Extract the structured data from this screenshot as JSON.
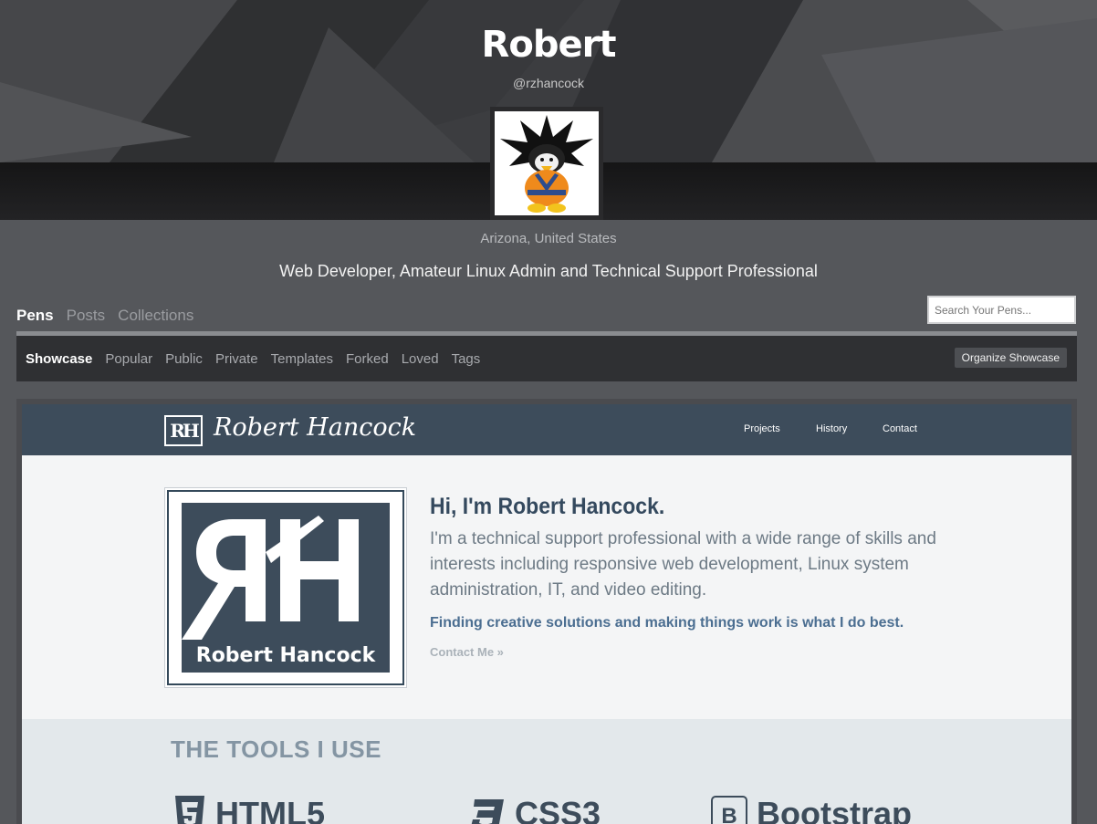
{
  "profile": {
    "name": "Robert",
    "handle": "@rzhancock",
    "location": "Arizona, United States",
    "bio": "Web Developer, Amateur Linux Admin and Technical Support Professional"
  },
  "main_tabs": [
    {
      "label": "Pens",
      "active": true
    },
    {
      "label": "Posts",
      "active": false
    },
    {
      "label": "Collections",
      "active": false
    }
  ],
  "search": {
    "placeholder": "Search Your Pens..."
  },
  "sub_tabs": [
    {
      "label": "Showcase",
      "active": true
    },
    {
      "label": "Popular",
      "active": false
    },
    {
      "label": "Public",
      "active": false
    },
    {
      "label": "Private",
      "active": false
    },
    {
      "label": "Templates",
      "active": false
    },
    {
      "label": "Forked",
      "active": false
    },
    {
      "label": "Loved",
      "active": false
    },
    {
      "label": "Tags",
      "active": false
    }
  ],
  "organize_button": "Organize Showcase",
  "preview": {
    "logo_mark": "RH",
    "logo_text": "Robert Hancock",
    "nav_links": [
      "Projects",
      "History",
      "Contact"
    ],
    "logo_caption": "Robert Hancock",
    "heading": "Hi, I'm Robert Hancock.",
    "intro": "I'm a technical support professional with a wide range of skills and interests including responsive web development, Linux system administration, IT, and video editing.",
    "tagline": "Finding creative solutions and making things work is what I do best.",
    "contact_link": "Contact Me »",
    "tools_title": "THE TOOLS I USE",
    "tools": [
      {
        "name": "HTML5",
        "icon": "html5-icon"
      },
      {
        "name": "CSS3",
        "icon": "css3-icon"
      },
      {
        "name": "Bootstrap",
        "icon": "bootstrap-icon"
      }
    ]
  },
  "colors": {
    "page_bg": "#55575b",
    "preview_nav": "#3d4c5b",
    "tagline": "#4b6e91"
  }
}
